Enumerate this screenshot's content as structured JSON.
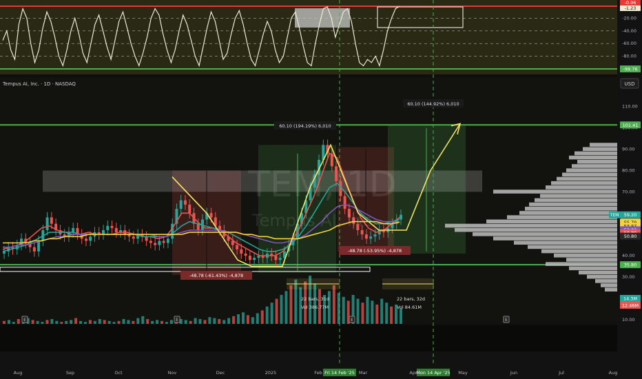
{
  "header": {
    "symbol_title": "Tempus AI, Inc. · 1D · NASDAQ",
    "currency_button": "USD",
    "watermark_ticker": "TEM, 1D",
    "watermark_name": "Tempus AI, Inc."
  },
  "oscillator": {
    "axis_ticks": [
      "-0.06",
      "-1.23",
      "-20.00",
      "-40.00",
      "-60.00",
      "-80.00",
      "-99.76"
    ],
    "upper_line": "-0.06",
    "lower_line": "-99.76",
    "current_badge": "-1.23",
    "level_ticks": [
      "-20.00",
      "-40.00",
      "-60.00",
      "-80.00"
    ],
    "series": [
      -55,
      -40,
      -70,
      -85,
      -30,
      -5,
      -20,
      -60,
      -90,
      -70,
      -35,
      -10,
      -25,
      -50,
      -80,
      -95,
      -70,
      -40,
      -20,
      -45,
      -75,
      -90,
      -60,
      -30,
      -15,
      -40,
      -65,
      -85,
      -55,
      -25,
      -10,
      -35,
      -60,
      -80,
      -95,
      -75,
      -50,
      -20,
      -5,
      -15,
      -45,
      -70,
      -90,
      -70,
      -40,
      -15,
      -30,
      -55,
      -80,
      -95,
      -65,
      -35,
      -10,
      -25,
      -55,
      -85,
      -75,
      -45,
      -20,
      -8,
      -30,
      -60,
      -85,
      -95,
      -70,
      -45,
      -25,
      -40,
      -70,
      -90,
      -80,
      -50,
      -20,
      -10,
      -35,
      -65,
      -90,
      -95,
      -60,
      -30,
      -5,
      -2,
      -20,
      -50,
      -30,
      -10,
      -5,
      -25,
      -60,
      -90,
      -95,
      -85,
      -90,
      -80,
      -95,
      -70,
      -40,
      -20,
      -5,
      -1.2
    ]
  },
  "price_axis": {
    "ticks": [
      "110.00",
      "100.00",
      "90.00",
      "80.00",
      "70.00",
      "60.00",
      "50.00",
      "40.00",
      "30.00",
      "20.00",
      "10.00"
    ],
    "badges": [
      {
        "label": "101.41",
        "value": 101.41,
        "color": "#4caf50"
      },
      {
        "label": "59.20",
        "value": 59.2,
        "color": "#26a69a"
      },
      {
        "label": "55.89",
        "value": 55.89,
        "color": "#2a2a2a"
      },
      {
        "label": "55.79",
        "value": 55.79,
        "color": "#f5d33c"
      },
      {
        "label": "53.87",
        "value": 53.87,
        "color": "#f5d33c"
      },
      {
        "label": "52.22",
        "value": 52.22,
        "color": "#7e57c2"
      },
      {
        "label": "50.80",
        "value": 50.8,
        "color": "#ef5350"
      },
      {
        "label": "50.80",
        "value": 49.2,
        "color": "#2a2a2a"
      },
      {
        "label": "35.80",
        "value": 35.8,
        "color": "#4caf50"
      }
    ],
    "ticker_badge": "TEM",
    "volume_badges": [
      {
        "label": "14.3M",
        "color": "#26a69a"
      },
      {
        "label": "12.46M",
        "color": "#ef5350"
      }
    ]
  },
  "chart_data": {
    "type": "candlestick",
    "price_range": [
      8,
      118
    ],
    "months": [
      "Aug",
      "Sep",
      "Oct",
      "Nov",
      "Dec",
      "2025",
      "Feb",
      "Mar",
      "Apr",
      "May",
      "Jun",
      "Jul",
      "Aug"
    ],
    "highlighted_dates": [
      "Fri 14 Feb '25",
      "Mon 14 Apr '25"
    ],
    "horizontal_levels": [
      101.41,
      35.8
    ],
    "close_series": [
      42,
      44,
      43,
      45,
      48,
      46,
      44,
      42,
      47,
      52,
      58,
      55,
      52,
      50,
      49,
      51,
      53,
      50,
      48,
      47,
      49,
      51,
      50,
      52,
      54,
      53,
      51,
      52,
      50,
      49,
      48,
      50,
      49,
      47,
      46,
      45,
      47,
      46,
      48,
      55,
      62,
      66,
      64,
      60,
      55,
      52,
      57,
      60,
      58,
      54,
      52,
      49,
      47,
      45,
      43,
      41,
      40,
      38,
      39,
      40,
      39,
      41,
      40,
      38,
      39,
      42,
      45,
      48,
      55,
      60,
      66,
      72,
      78,
      85,
      92,
      88,
      82,
      75,
      68,
      62,
      58,
      55,
      52,
      50,
      48,
      49,
      50,
      52,
      51,
      53,
      55,
      57,
      59.2
    ],
    "ma_series": [
      {
        "name": "MA-fast",
        "color": "#ef5350",
        "values": [
          43,
          44,
          45,
          47,
          50,
          53,
          54,
          52,
          51,
          50,
          50,
          51,
          50,
          50,
          50,
          51,
          51,
          50,
          49,
          49,
          48,
          49,
          54,
          60,
          60,
          56,
          53,
          53,
          52,
          49,
          46,
          44,
          42,
          40,
          40,
          40,
          42,
          46,
          52,
          60,
          68,
          78,
          88,
          86,
          76,
          66,
          58,
          53,
          51,
          52,
          55,
          58
        ]
      },
      {
        "name": "MA-mid",
        "color": "#26a69a",
        "values": [
          42,
          43,
          44,
          45,
          47,
          49,
          51,
          51,
          51,
          51,
          50,
          50,
          50,
          50,
          50,
          50,
          50,
          50,
          49,
          49,
          49,
          49,
          51,
          54,
          56,
          55,
          54,
          53,
          52,
          51,
          49,
          47,
          45,
          43,
          42,
          42,
          43,
          45,
          49,
          54,
          60,
          66,
          72,
          74,
          70,
          65,
          60,
          57,
          55,
          55,
          56,
          57
        ]
      },
      {
        "name": "MA-slow",
        "color": "#7e57c2",
        "values": [
          44,
          44,
          45,
          45,
          46,
          47,
          48,
          49,
          49,
          50,
          50,
          50,
          50,
          50,
          50,
          50,
          50,
          50,
          50,
          50,
          49,
          49,
          50,
          51,
          52,
          52,
          52,
          52,
          52,
          51,
          51,
          50,
          49,
          48,
          47,
          46,
          46,
          47,
          48,
          50,
          53,
          56,
          60,
          63,
          64,
          63,
          61,
          59,
          57,
          56,
          56,
          55.9
        ]
      },
      {
        "name": "MA-long",
        "color": "#f5d33c",
        "values": [
          46,
          46,
          46,
          46,
          47,
          47,
          48,
          48,
          49,
          49,
          49,
          50,
          50,
          50,
          50,
          50,
          50,
          50,
          50,
          50,
          50,
          50,
          50,
          50,
          51,
          51,
          51,
          51,
          51,
          51,
          51,
          50,
          50,
          49,
          49,
          48,
          48,
          48,
          48,
          49,
          50,
          51,
          52,
          54,
          55,
          56,
          56,
          56,
          56,
          55,
          55,
          55.8
        ]
      }
    ],
    "projection_path": [
      [
        250,
        77
      ],
      [
        300,
        60
      ],
      [
        345,
        38
      ],
      [
        365,
        35
      ],
      [
        410,
        35
      ],
      [
        450,
        72
      ],
      [
        480,
        92
      ],
      [
        520,
        60
      ],
      [
        550,
        52
      ],
      [
        590,
        52
      ],
      [
        625,
        80
      ],
      [
        668,
        102
      ]
    ],
    "annotations": [
      {
        "label": "60.10 (194.19%) 6,010",
        "kind": "gain"
      },
      {
        "label": "60.10 (144.92%) 6,010",
        "kind": "gain"
      },
      {
        "label": "-48.78 (-61.43%) -4,878",
        "kind": "loss"
      },
      {
        "label": "-48.78 (-53.95%) -4,878",
        "kind": "loss"
      },
      {
        "label": "22 bars, 31d",
        "kind": "range"
      },
      {
        "label": "Vol 386.77M",
        "kind": "range"
      },
      {
        "label": "22 bars, 32d",
        "kind": "range"
      },
      {
        "label": "Vol 84.61M",
        "kind": "range"
      }
    ],
    "volume_profile_rows": [
      {
        "price": 92,
        "width": 40
      },
      {
        "price": 90,
        "width": 50
      },
      {
        "price": 88,
        "width": 62
      },
      {
        "price": 86,
        "width": 70
      },
      {
        "price": 84,
        "width": 58
      },
      {
        "price": 82,
        "width": 66
      },
      {
        "price": 80,
        "width": 74
      },
      {
        "price": 78,
        "width": 80
      },
      {
        "price": 76,
        "width": 88
      },
      {
        "price": 74,
        "width": 96
      },
      {
        "price": 72,
        "width": 104
      },
      {
        "price": 70,
        "width": 180
      },
      {
        "price": 68,
        "width": 112
      },
      {
        "price": 66,
        "width": 120
      },
      {
        "price": 64,
        "width": 128
      },
      {
        "price": 62,
        "width": 134
      },
      {
        "price": 60,
        "width": 142
      },
      {
        "price": 58,
        "width": 160
      },
      {
        "price": 56,
        "width": 190
      },
      {
        "price": 54,
        "width": 250
      },
      {
        "price": 52,
        "width": 236
      },
      {
        "price": 50,
        "width": 210
      },
      {
        "price": 48,
        "width": 180
      },
      {
        "price": 46,
        "width": 150
      },
      {
        "price": 44,
        "width": 130
      },
      {
        "price": 42,
        "width": 110
      },
      {
        "price": 40,
        "width": 92
      },
      {
        "price": 38,
        "width": 74
      },
      {
        "price": 36,
        "width": 104
      },
      {
        "price": 34,
        "width": 70
      },
      {
        "price": 32,
        "width": 56
      },
      {
        "price": 30,
        "width": 44
      },
      {
        "price": 28,
        "width": 32
      },
      {
        "price": 26,
        "width": 24
      },
      {
        "price": 24,
        "width": 18
      }
    ],
    "volume_bars": [
      3,
      4,
      2,
      5,
      3,
      6,
      4,
      3,
      2,
      4,
      5,
      3,
      2,
      3,
      4,
      6,
      3,
      2,
      4,
      3,
      5,
      4,
      3,
      2,
      3,
      5,
      4,
      3,
      6,
      8,
      5,
      3,
      4,
      3,
      2,
      4,
      3,
      5,
      4,
      3,
      6,
      5,
      4,
      7,
      6,
      5,
      4,
      6,
      8,
      10,
      12,
      9,
      7,
      11,
      14,
      18,
      22,
      26,
      30,
      34,
      40,
      46,
      38,
      44,
      50,
      42,
      36,
      30,
      34,
      40,
      32,
      28,
      24,
      30,
      26,
      22,
      28,
      24,
      20,
      26,
      22,
      18,
      20,
      16
    ]
  }
}
